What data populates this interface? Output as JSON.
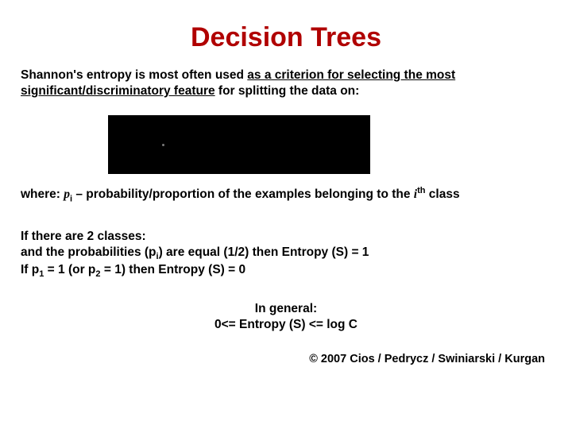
{
  "title": "Decision Trees",
  "intro": {
    "l1a": "Shannon's entropy is most often used ",
    "l1b": "as a criterion for selecting the most",
    "l2a": "significant/discriminatory feature",
    "l2b": " for splitting the data on:"
  },
  "where": {
    "prefix": "where: ",
    "p": "p",
    "i": "i",
    "mid": " – probability/proportion of the examples belonging to the ",
    "ith_i": "i",
    "ith_th": "th",
    "suffix": " class"
  },
  "two_class": {
    "l1": "If there are 2 classes:",
    "l2a": "and the probabilities (p",
    "l2b": ") are equal (1/2)  then  Entropy (S) = 1",
    "l3a": "If  p",
    "l3b": " = 1  (or  p",
    "l3c": " = 1)  then   Entropy (S) = 0",
    "sub_i": "i",
    "sub_1": "1",
    "sub_2": "2"
  },
  "general": {
    "l1": "In general:",
    "l2": "0<=  Entropy (S)  <= log C"
  },
  "copyright": "© 2007 Cios / Pedrycz / Swiniarski / Kurgan"
}
